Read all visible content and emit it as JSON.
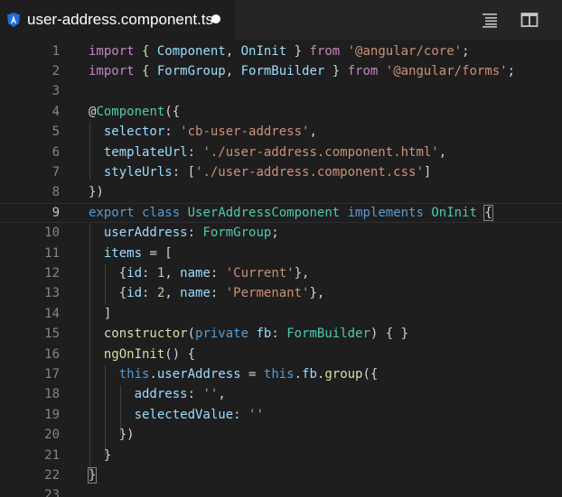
{
  "tab": {
    "title": "user-address.component.ts"
  },
  "colors": {
    "editor_bg": "#1e1e1e",
    "angular_icon": "#1e6fd9",
    "keyword": "#c586c0",
    "storage": "#569cd6",
    "variable": "#9cdcfe",
    "string": "#ce9178",
    "class": "#4ec9b0",
    "function": "#dcdcaa",
    "number": "#b5cea8"
  },
  "icons": [
    "angular-icon",
    "dirty-dot-icon",
    "toggle-minimap-icon",
    "split-editor-icon"
  ],
  "current_line": 9,
  "lines": [
    {
      "n": "1",
      "tokens": [
        [
          "k",
          "import"
        ],
        [
          "p",
          " { "
        ],
        [
          "v",
          "Component"
        ],
        [
          "p",
          ", "
        ],
        [
          "v",
          "OnInit"
        ],
        [
          "p",
          " } "
        ],
        [
          "k",
          "from"
        ],
        [
          "p",
          " "
        ],
        [
          "s",
          "'@angular/core'"
        ],
        [
          "p",
          ";"
        ]
      ]
    },
    {
      "n": "2",
      "tokens": [
        [
          "k",
          "import"
        ],
        [
          "p",
          " { "
        ],
        [
          "v",
          "FormGroup"
        ],
        [
          "p",
          ", "
        ],
        [
          "v",
          "FormBuilder"
        ],
        [
          "p",
          " } "
        ],
        [
          "k",
          "from"
        ],
        [
          "p",
          " "
        ],
        [
          "s",
          "'@angular/forms'"
        ],
        [
          "p",
          ";"
        ]
      ]
    },
    {
      "n": "3",
      "tokens": []
    },
    {
      "n": "4",
      "tokens": [
        [
          "p",
          "@"
        ],
        [
          "c",
          "Component"
        ],
        [
          "p",
          "({"
        ]
      ]
    },
    {
      "n": "5",
      "tokens": [
        [
          "p",
          "  "
        ],
        [
          "v",
          "selector"
        ],
        [
          "p",
          ": "
        ],
        [
          "s",
          "'cb-user-address'"
        ],
        [
          "p",
          ","
        ]
      ]
    },
    {
      "n": "6",
      "tokens": [
        [
          "p",
          "  "
        ],
        [
          "v",
          "templateUrl"
        ],
        [
          "p",
          ": "
        ],
        [
          "s",
          "'./user-address.component.html'"
        ],
        [
          "p",
          ","
        ]
      ]
    },
    {
      "n": "7",
      "tokens": [
        [
          "p",
          "  "
        ],
        [
          "v",
          "styleUrls"
        ],
        [
          "p",
          ": ["
        ],
        [
          "s",
          "'./user-address.component.css'"
        ],
        [
          "p",
          "]"
        ]
      ]
    },
    {
      "n": "8",
      "tokens": [
        [
          "p",
          "})"
        ]
      ]
    },
    {
      "n": "9",
      "tokens": [
        [
          "kw",
          "export"
        ],
        [
          "p",
          " "
        ],
        [
          "kw",
          "class"
        ],
        [
          "p",
          " "
        ],
        [
          "c",
          "UserAddressComponent"
        ],
        [
          "p",
          " "
        ],
        [
          "kw",
          "implements"
        ],
        [
          "p",
          " "
        ],
        [
          "c",
          "OnInit"
        ],
        [
          "p",
          " "
        ],
        [
          "b",
          "{"
        ]
      ]
    },
    {
      "n": "10",
      "tokens": [
        [
          "p",
          "  "
        ],
        [
          "v",
          "userAddress"
        ],
        [
          "p",
          ": "
        ],
        [
          "c",
          "FormGroup"
        ],
        [
          "p",
          ";"
        ]
      ]
    },
    {
      "n": "11",
      "tokens": [
        [
          "p",
          "  "
        ],
        [
          "v",
          "items"
        ],
        [
          "p",
          " = ["
        ]
      ]
    },
    {
      "n": "12",
      "tokens": [
        [
          "p",
          "    {"
        ],
        [
          "v",
          "id"
        ],
        [
          "p",
          ": "
        ],
        [
          "num",
          "1"
        ],
        [
          "p",
          ", "
        ],
        [
          "v",
          "name"
        ],
        [
          "p",
          ": "
        ],
        [
          "s",
          "'Current'"
        ],
        [
          "p",
          "},"
        ]
      ]
    },
    {
      "n": "13",
      "tokens": [
        [
          "p",
          "    {"
        ],
        [
          "v",
          "id"
        ],
        [
          "p",
          ": "
        ],
        [
          "num",
          "2"
        ],
        [
          "p",
          ", "
        ],
        [
          "v",
          "name"
        ],
        [
          "p",
          ": "
        ],
        [
          "s",
          "'Permenant'"
        ],
        [
          "p",
          "},"
        ]
      ]
    },
    {
      "n": "14",
      "tokens": [
        [
          "p",
          "  ]"
        ]
      ]
    },
    {
      "n": "15",
      "tokens": [
        [
          "p",
          "  "
        ],
        [
          "f",
          "constructor"
        ],
        [
          "p",
          "("
        ],
        [
          "kw",
          "private"
        ],
        [
          "p",
          " "
        ],
        [
          "v",
          "fb"
        ],
        [
          "p",
          ": "
        ],
        [
          "c",
          "FormBuilder"
        ],
        [
          "p",
          ") { }"
        ]
      ]
    },
    {
      "n": "16",
      "tokens": [
        [
          "p",
          "  "
        ],
        [
          "f",
          "ngOnInit"
        ],
        [
          "p",
          "() {"
        ]
      ]
    },
    {
      "n": "17",
      "tokens": [
        [
          "p",
          "    "
        ],
        [
          "kw",
          "this"
        ],
        [
          "p",
          "."
        ],
        [
          "v",
          "userAddress"
        ],
        [
          "p",
          " = "
        ],
        [
          "kw",
          "this"
        ],
        [
          "p",
          "."
        ],
        [
          "v",
          "fb"
        ],
        [
          "p",
          "."
        ],
        [
          "f",
          "group"
        ],
        [
          "p",
          "({"
        ]
      ]
    },
    {
      "n": "18",
      "tokens": [
        [
          "p",
          "      "
        ],
        [
          "v",
          "address"
        ],
        [
          "p",
          ": "
        ],
        [
          "s",
          "''"
        ],
        [
          "p",
          ","
        ]
      ]
    },
    {
      "n": "19",
      "tokens": [
        [
          "p",
          "      "
        ],
        [
          "v",
          "selectedValue"
        ],
        [
          "p",
          ": "
        ],
        [
          "s",
          "''"
        ]
      ]
    },
    {
      "n": "20",
      "tokens": [
        [
          "p",
          "    })"
        ]
      ]
    },
    {
      "n": "21",
      "tokens": [
        [
          "p",
          "  }"
        ]
      ]
    },
    {
      "n": "22",
      "tokens": [
        [
          "b",
          "}"
        ]
      ]
    },
    {
      "n": "23",
      "tokens": []
    }
  ]
}
